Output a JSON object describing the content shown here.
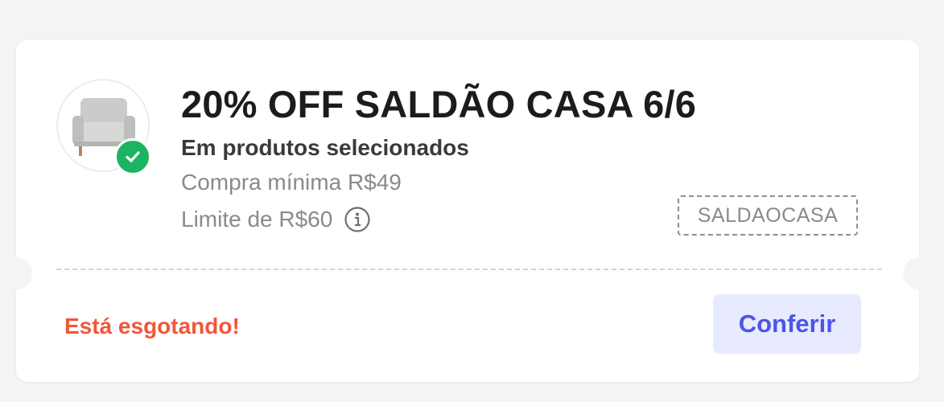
{
  "coupon": {
    "title": "20% OFF SALDÃO CASA 6/6",
    "subtitle": "Em produtos selecionados",
    "min_purchase": "Compra mínima R$49",
    "limit": "Limite de R$60",
    "code": "SALDAOCASA",
    "stock_alert": "Está esgotando!",
    "button_label": "Conferir",
    "product_image": "armchair-image",
    "badge_icon": "check-icon",
    "info_icon": "info-icon"
  },
  "colors": {
    "background": "#f4f4f4",
    "card": "#ffffff",
    "title": "#1c1c1c",
    "muted_text": "#8a8a8a",
    "alert": "#f0573a",
    "button_bg": "#e8ebff",
    "button_text": "#4b55e8",
    "badge": "#1bb463"
  }
}
